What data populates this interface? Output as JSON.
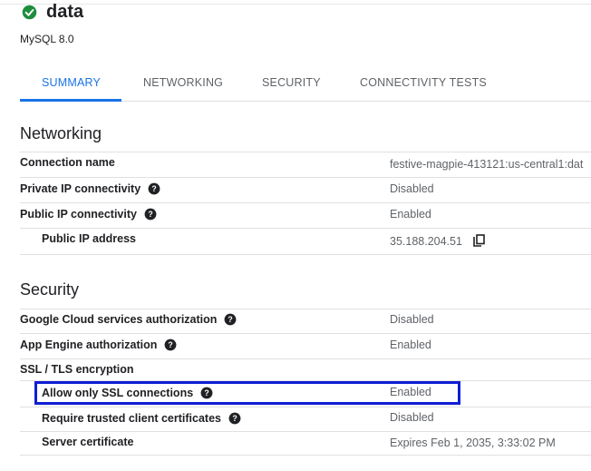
{
  "header": {
    "instance_name": "data",
    "db_version": "MySQL 8.0",
    "status_icon": "check-circle-icon",
    "status_color": "#1e8e3e"
  },
  "tabs": [
    {
      "label": "SUMMARY",
      "active": true
    },
    {
      "label": "NETWORKING",
      "active": false
    },
    {
      "label": "SECURITY",
      "active": false
    },
    {
      "label": "CONNECTIVITY TESTS",
      "active": false
    }
  ],
  "accent_color": "#1a73e8",
  "networking": {
    "title": "Networking",
    "rows": [
      {
        "label": "Connection name",
        "value": "festive-magpie-413121:us-central1:dat"
      },
      {
        "label": "Private IP connectivity",
        "value": "Disabled"
      },
      {
        "label": "Public IP connectivity",
        "value": "Enabled"
      },
      {
        "label": "Public IP address",
        "value": "35.188.204.51"
      }
    ]
  },
  "security": {
    "title": "Security",
    "rows": [
      {
        "label": "Google Cloud services authorization",
        "value": "Disabled"
      },
      {
        "label": "App Engine authorization",
        "value": "Enabled"
      },
      {
        "label": "SSL / TLS encryption",
        "value": ""
      },
      {
        "label": "Allow only SSL connections",
        "value": "Enabled"
      },
      {
        "label": "Require trusted client certificates",
        "value": "Disabled"
      },
      {
        "label": "Server certificate",
        "value": "Expires Feb 1, 2035, 3:33:02 PM"
      }
    ]
  },
  "highlight_color": "#0f1ed4"
}
